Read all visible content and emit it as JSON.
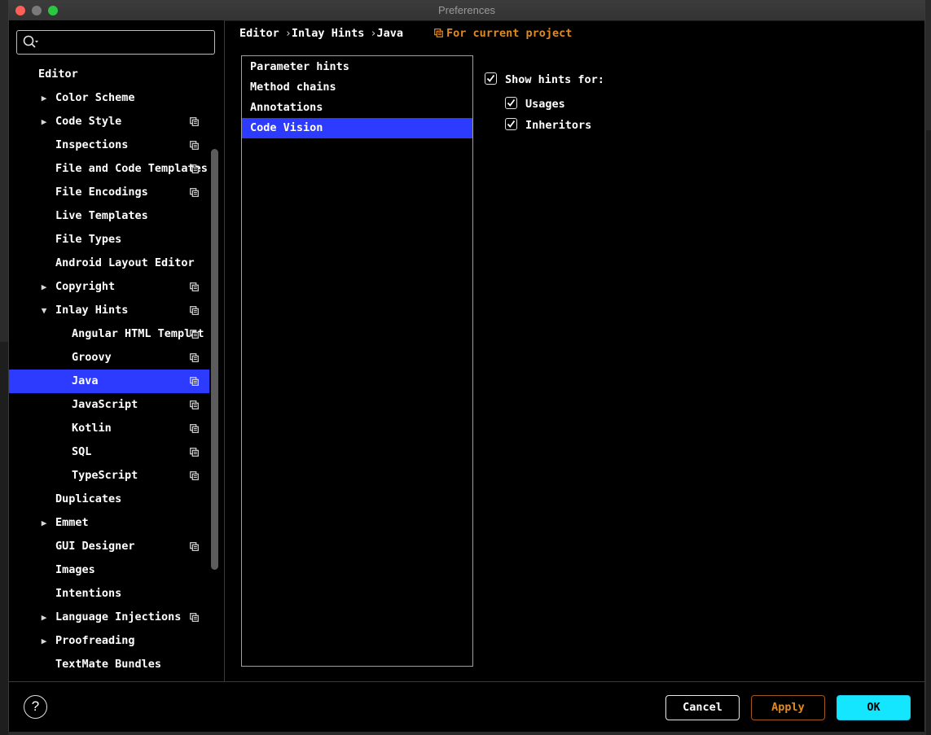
{
  "window": {
    "title": "Preferences"
  },
  "search": {
    "placeholder": ""
  },
  "sidebar": {
    "items": [
      {
        "label": "Editor",
        "level": 0,
        "arrow": "",
        "project": false
      },
      {
        "label": "Color Scheme",
        "level": 1,
        "arrow": "collapsed",
        "project": false
      },
      {
        "label": "Code Style",
        "level": 1,
        "arrow": "collapsed",
        "project": true
      },
      {
        "label": "Inspections",
        "level": 1,
        "arrow": "",
        "project": true
      },
      {
        "label": "File and Code Templates",
        "level": 1,
        "arrow": "",
        "project": true
      },
      {
        "label": "File Encodings",
        "level": 1,
        "arrow": "",
        "project": true
      },
      {
        "label": "Live Templates",
        "level": 1,
        "arrow": "",
        "project": false
      },
      {
        "label": "File Types",
        "level": 1,
        "arrow": "",
        "project": false
      },
      {
        "label": "Android Layout Editor",
        "level": 1,
        "arrow": "",
        "project": false
      },
      {
        "label": "Copyright",
        "level": 1,
        "arrow": "collapsed",
        "project": true
      },
      {
        "label": "Inlay Hints",
        "level": 1,
        "arrow": "expanded",
        "project": true
      },
      {
        "label": "Angular HTML Templat",
        "level": 2,
        "arrow": "",
        "project": true
      },
      {
        "label": "Groovy",
        "level": 2,
        "arrow": "",
        "project": true
      },
      {
        "label": "Java",
        "level": 2,
        "arrow": "",
        "project": true,
        "selected": true
      },
      {
        "label": "JavaScript",
        "level": 2,
        "arrow": "",
        "project": true
      },
      {
        "label": "Kotlin",
        "level": 2,
        "arrow": "",
        "project": true
      },
      {
        "label": "SQL",
        "level": 2,
        "arrow": "",
        "project": true
      },
      {
        "label": "TypeScript",
        "level": 2,
        "arrow": "",
        "project": true
      },
      {
        "label": "Duplicates",
        "level": 1,
        "arrow": "",
        "project": false
      },
      {
        "label": "Emmet",
        "level": 1,
        "arrow": "collapsed",
        "project": false
      },
      {
        "label": "GUI Designer",
        "level": 1,
        "arrow": "",
        "project": true
      },
      {
        "label": "Images",
        "level": 1,
        "arrow": "",
        "project": false
      },
      {
        "label": "Intentions",
        "level": 1,
        "arrow": "",
        "project": false
      },
      {
        "label": "Language Injections",
        "level": 1,
        "arrow": "collapsed",
        "project": true
      },
      {
        "label": "Proofreading",
        "level": 1,
        "arrow": "collapsed",
        "project": false
      },
      {
        "label": "TextMate Bundles",
        "level": 1,
        "arrow": "",
        "project": false
      }
    ]
  },
  "breadcrumb": {
    "parts": [
      "Editor",
      "Inlay Hints",
      "Java"
    ],
    "separator": "›"
  },
  "scope": {
    "label": "For current project"
  },
  "hint_list": {
    "items": [
      {
        "label": "Parameter hints",
        "selected": false
      },
      {
        "label": "Method chains",
        "selected": false
      },
      {
        "label": "Annotations",
        "selected": false
      },
      {
        "label": "Code Vision",
        "selected": true
      }
    ]
  },
  "options": {
    "show_hints": {
      "label": "Show hints for:",
      "checked": true
    },
    "usages": {
      "label": "Usages",
      "checked": true
    },
    "inheritors": {
      "label": "Inheritors",
      "checked": true
    }
  },
  "footer": {
    "help_label": "?",
    "cancel_label": "Cancel",
    "apply_label": "Apply",
    "ok_label": "OK"
  },
  "colors": {
    "selection": "#2d3bff",
    "project_accent": "#e08a1e",
    "ok_button": "#15e6ff"
  },
  "icons": {
    "search": "search-icon",
    "project_scope": "copy-icon",
    "expand": "triangle-right-icon",
    "collapse": "triangle-down-icon"
  }
}
